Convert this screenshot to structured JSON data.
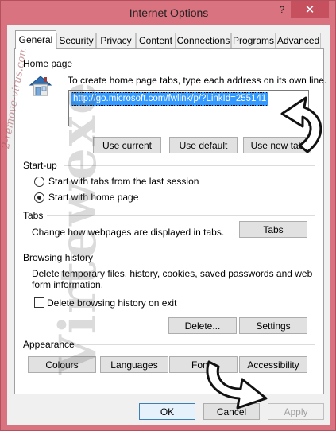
{
  "window": {
    "title": "Internet Options",
    "help_glyph": "?",
    "close_glyph": "✕"
  },
  "tabs": [
    {
      "label": "General",
      "active": true
    },
    {
      "label": "Security"
    },
    {
      "label": "Privacy"
    },
    {
      "label": "Content"
    },
    {
      "label": "Connections"
    },
    {
      "label": "Programs"
    },
    {
      "label": "Advanced"
    }
  ],
  "home_page": {
    "group_label": "Home page",
    "instructions": "To create home page tabs, type each address on its own line.",
    "url_value": "http://go.microsoft.com/fwlink/p/?LinkId=255141",
    "use_current": "Use current",
    "use_default": "Use default",
    "use_new_tab": "Use new tab"
  },
  "startup": {
    "group_label": "Start-up",
    "option_last_session": "Start with tabs from the last session",
    "option_home_page": "Start with home page",
    "selected": "home_page"
  },
  "tabs_section": {
    "group_label": "Tabs",
    "description": "Change how webpages are displayed in tabs.",
    "tabs_button": "Tabs"
  },
  "browsing_history": {
    "group_label": "Browsing history",
    "description_line1": "Delete temporary files, history, cookies, saved passwords and web",
    "description_line2": "form information.",
    "delete_on_exit": "Delete browsing history on exit",
    "delete_on_exit_checked": false,
    "delete_button": "Delete...",
    "settings_button": "Settings"
  },
  "appearance": {
    "group_label": "Appearance",
    "colours": "Colours",
    "languages": "Languages",
    "fonts": "Fonts",
    "accessibility": "Accessibility"
  },
  "footer": {
    "ok": "OK",
    "cancel": "Cancel",
    "apply": "Apply"
  },
  "watermarks": {
    "large": "Virtewexe",
    "small": "2-remove-virus.com"
  },
  "icons": {
    "home": "house-icon",
    "arrow": "curved-arrow-icon"
  },
  "colors": {
    "title_bar": "#d8737f",
    "close_button": "#c7505f",
    "selection": "#3399ff"
  }
}
